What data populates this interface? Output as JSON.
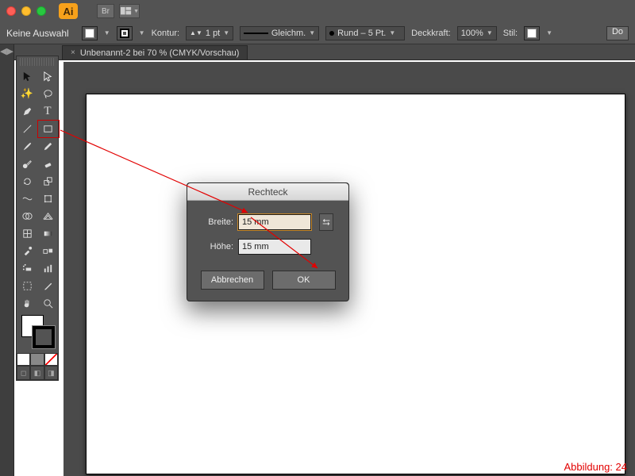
{
  "titlebar": {
    "app_abbrev": "Ai",
    "bridge_label": "Br"
  },
  "controlbar": {
    "selection_label": "Keine Auswahl",
    "stroke_label": "Kontur:",
    "stroke_weight": "1 pt",
    "stroke_profile": "Gleichm.",
    "brush_label": "Rund – 5 Pt.",
    "opacity_label": "Deckkraft:",
    "opacity_value": "100%",
    "style_label": "Stil:",
    "doc_setup": "Do"
  },
  "document": {
    "tab_label": "Unbenannt-2 bei 70 % (CMYK/Vorschau)"
  },
  "tools": {
    "names": [
      [
        "selection-tool",
        "direct-selection-tool"
      ],
      [
        "magic-wand-tool",
        "lasso-tool"
      ],
      [
        "pen-tool",
        "type-tool"
      ],
      [
        "line-tool",
        "rectangle-tool"
      ],
      [
        "paintbrush-tool",
        "pencil-tool"
      ],
      [
        "blob-brush-tool",
        "eraser-tool"
      ],
      [
        "rotate-tool",
        "scale-tool"
      ],
      [
        "width-tool",
        "free-transform-tool"
      ],
      [
        "shape-builder-tool",
        "perspective-grid-tool"
      ],
      [
        "mesh-tool",
        "gradient-tool"
      ],
      [
        "eyedropper-tool",
        "blend-tool"
      ],
      [
        "symbol-sprayer-tool",
        "column-graph-tool"
      ],
      [
        "artboard-tool",
        "slice-tool"
      ],
      [
        "hand-tool",
        "zoom-tool"
      ]
    ]
  },
  "dialog": {
    "title": "Rechteck",
    "width_label": "Breite:",
    "height_label": "Höhe:",
    "width_value": "15 mm",
    "height_value": "15 mm",
    "cancel": "Abbrechen",
    "ok": "OK"
  },
  "caption": "Abbildung: 24"
}
